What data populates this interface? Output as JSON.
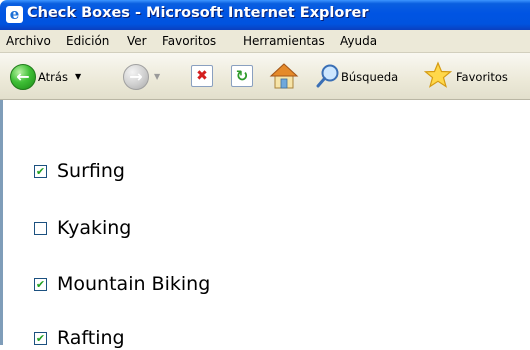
{
  "window": {
    "title": "Check Boxes - Microsoft Internet Explorer",
    "icon": "ie-logo-icon"
  },
  "menubar": {
    "items": [
      "Archivo",
      "Edición",
      "Ver",
      "Favoritos",
      "Herramientas",
      "Ayuda"
    ]
  },
  "toolbar": {
    "back_label": "Atrás",
    "search_label": "Búsqueda",
    "favorites_label": "Favoritos",
    "icons": [
      "back-arrow-icon",
      "forward-arrow-icon",
      "stop-icon",
      "refresh-icon",
      "home-icon",
      "search-icon",
      "favorites-star-icon"
    ]
  },
  "checkboxes": [
    {
      "label": "Surfing",
      "checked": true
    },
    {
      "label": "Kyaking",
      "checked": false
    },
    {
      "label": "Mountain Biking",
      "checked": true
    },
    {
      "label": "Rafting",
      "checked": true
    }
  ],
  "colors": {
    "titlebar": "#0054e3",
    "chrome": "#ece9d8",
    "checkmark": "#21a121"
  }
}
